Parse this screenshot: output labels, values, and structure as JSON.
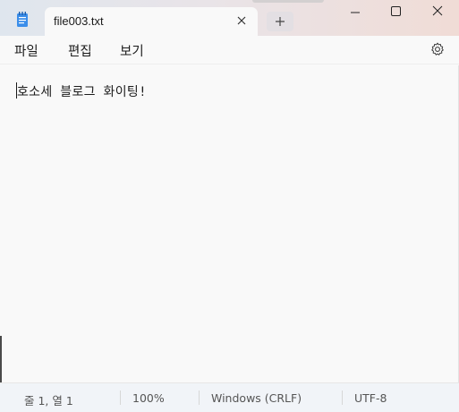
{
  "window": {
    "tab_title": "file003.txt",
    "new_tab_symbol": "+",
    "controls": [
      "minimize-icon",
      "maximize-icon",
      "close-icon"
    ]
  },
  "menu": {
    "file": "파일",
    "edit": "편집",
    "view": "보기"
  },
  "editor": {
    "content": "호소세 블로그 화이팅!"
  },
  "status": {
    "position": "줄 1, 열 1",
    "zoom": "100%",
    "line_ending": "Windows (CRLF)",
    "encoding": "UTF-8"
  },
  "colors": {
    "accent": "#0067c0",
    "app_icon": "#3b8eea"
  }
}
